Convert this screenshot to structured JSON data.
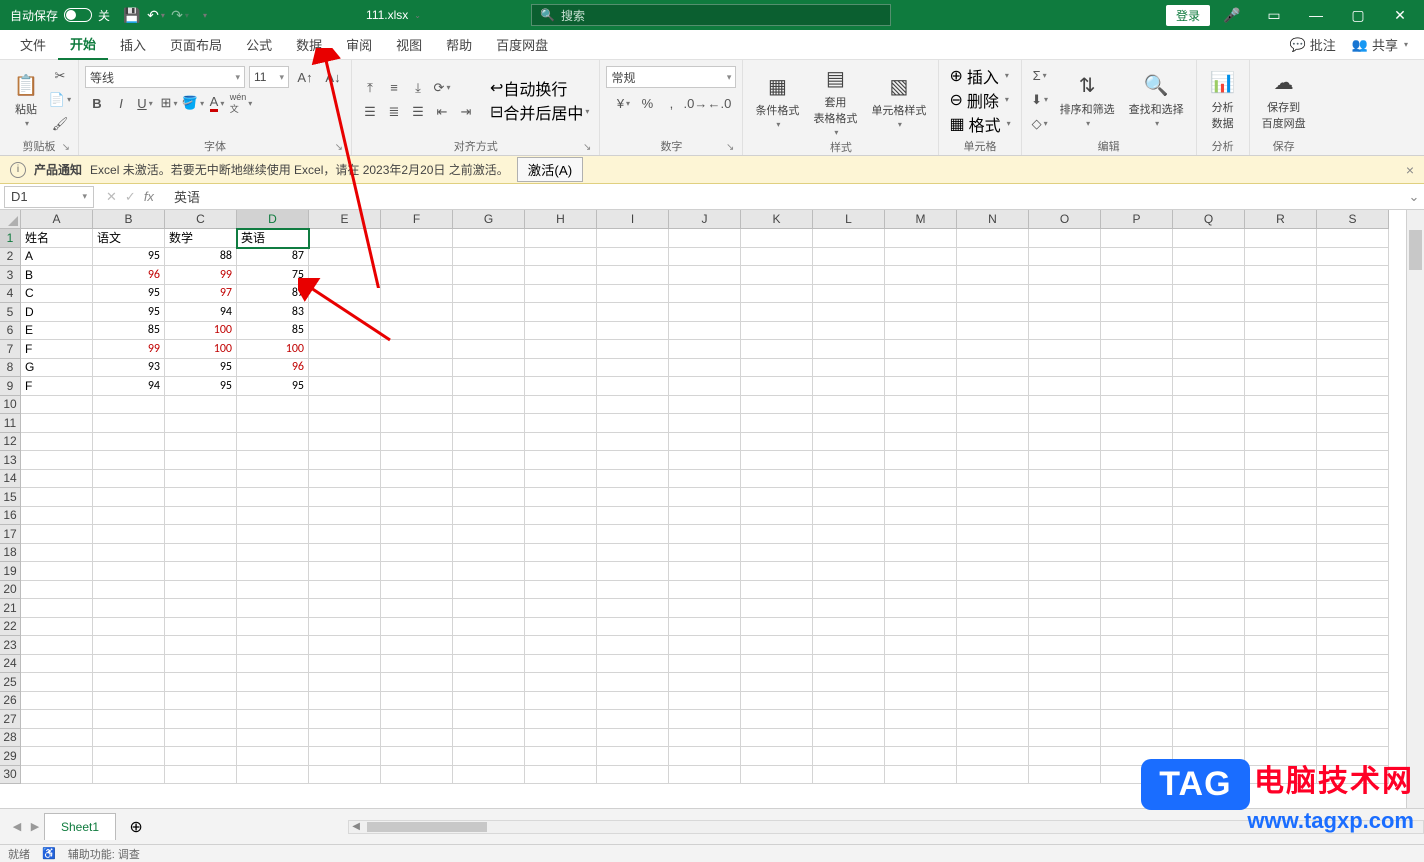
{
  "titlebar": {
    "autosave_label": "自动保存",
    "autosave_state": "关",
    "filename": "111.xlsx",
    "search_placeholder": "搜索",
    "login": "登录"
  },
  "tabs": {
    "file": "文件",
    "home": "开始",
    "insert": "插入",
    "layout": "页面布局",
    "formula": "公式",
    "data": "数据",
    "review": "审阅",
    "view": "视图",
    "help": "帮助",
    "baidu": "百度网盘",
    "comment": "批注",
    "share": "共享"
  },
  "ribbon": {
    "clipboard": {
      "label": "剪贴板",
      "paste": "粘贴"
    },
    "font": {
      "label": "字体",
      "name": "等线",
      "size": "11"
    },
    "align": {
      "label": "对齐方式",
      "wrap": "自动换行",
      "merge": "合并后居中"
    },
    "number": {
      "label": "数字",
      "format": "常规"
    },
    "style": {
      "label": "样式",
      "cond": "条件格式",
      "table": "套用\n表格格式",
      "cell": "单元格样式"
    },
    "cells": {
      "label": "单元格",
      "insert": "插入",
      "delete": "删除",
      "format": "格式"
    },
    "edit": {
      "label": "编辑",
      "sort": "排序和筛选",
      "find": "查找和选择"
    },
    "analysis": {
      "label": "分析",
      "analyze": "分析\n数据"
    },
    "save": {
      "label": "保存",
      "baidu": "保存到\n百度网盘"
    }
  },
  "notif": {
    "title": "产品通知",
    "msg": "Excel 未激活。若要无中断地继续使用 Excel，请在 2023年2月20日 之前激活。",
    "btn": "激活(A)"
  },
  "formula": {
    "cellref": "D1",
    "value": "英语"
  },
  "columns": [
    "A",
    "B",
    "C",
    "D",
    "E",
    "F",
    "G",
    "H",
    "I",
    "J",
    "K",
    "L",
    "M",
    "N",
    "O",
    "P",
    "Q",
    "R",
    "S"
  ],
  "rownums": [
    1,
    2,
    3,
    4,
    5,
    6,
    7,
    8,
    9,
    10,
    11,
    12,
    13,
    14,
    15,
    16,
    17,
    18,
    19,
    20,
    21,
    22,
    23,
    24,
    25,
    26,
    27,
    28,
    29,
    30
  ],
  "data": {
    "headers": [
      "姓名",
      "语文",
      "数学",
      "英语"
    ],
    "rows": [
      {
        "n": "A",
        "c": [
          {
            "v": "95"
          },
          {
            "v": "88"
          },
          {
            "v": "87"
          }
        ]
      },
      {
        "n": "B",
        "c": [
          {
            "v": "96",
            "r": 1
          },
          {
            "v": "99",
            "r": 1
          },
          {
            "v": "75"
          }
        ]
      },
      {
        "n": "C",
        "c": [
          {
            "v": "95"
          },
          {
            "v": "97",
            "r": 1
          },
          {
            "v": "87"
          }
        ]
      },
      {
        "n": "D",
        "c": [
          {
            "v": "95"
          },
          {
            "v": "94"
          },
          {
            "v": "83"
          }
        ]
      },
      {
        "n": "E",
        "c": [
          {
            "v": "85"
          },
          {
            "v": "100",
            "r": 1
          },
          {
            "v": "85"
          }
        ]
      },
      {
        "n": "F",
        "c": [
          {
            "v": "99",
            "r": 1
          },
          {
            "v": "100",
            "r": 1
          },
          {
            "v": "100",
            "r": 1
          }
        ]
      },
      {
        "n": "G",
        "c": [
          {
            "v": "93"
          },
          {
            "v": "95"
          },
          {
            "v": "96",
            "r": 1
          }
        ]
      },
      {
        "n": "F",
        "c": [
          {
            "v": "94"
          },
          {
            "v": "95"
          },
          {
            "v": "95"
          }
        ]
      }
    ],
    "selected": {
      "row": 1,
      "col": 4
    }
  },
  "sheet": {
    "name": "Sheet1"
  },
  "status": {
    "ready": "就绪",
    "acc": "辅助功能: 调查"
  },
  "watermark": {
    "tag": "TAG",
    "text": "电脑技术网",
    "url": "www.tagxp.com"
  }
}
